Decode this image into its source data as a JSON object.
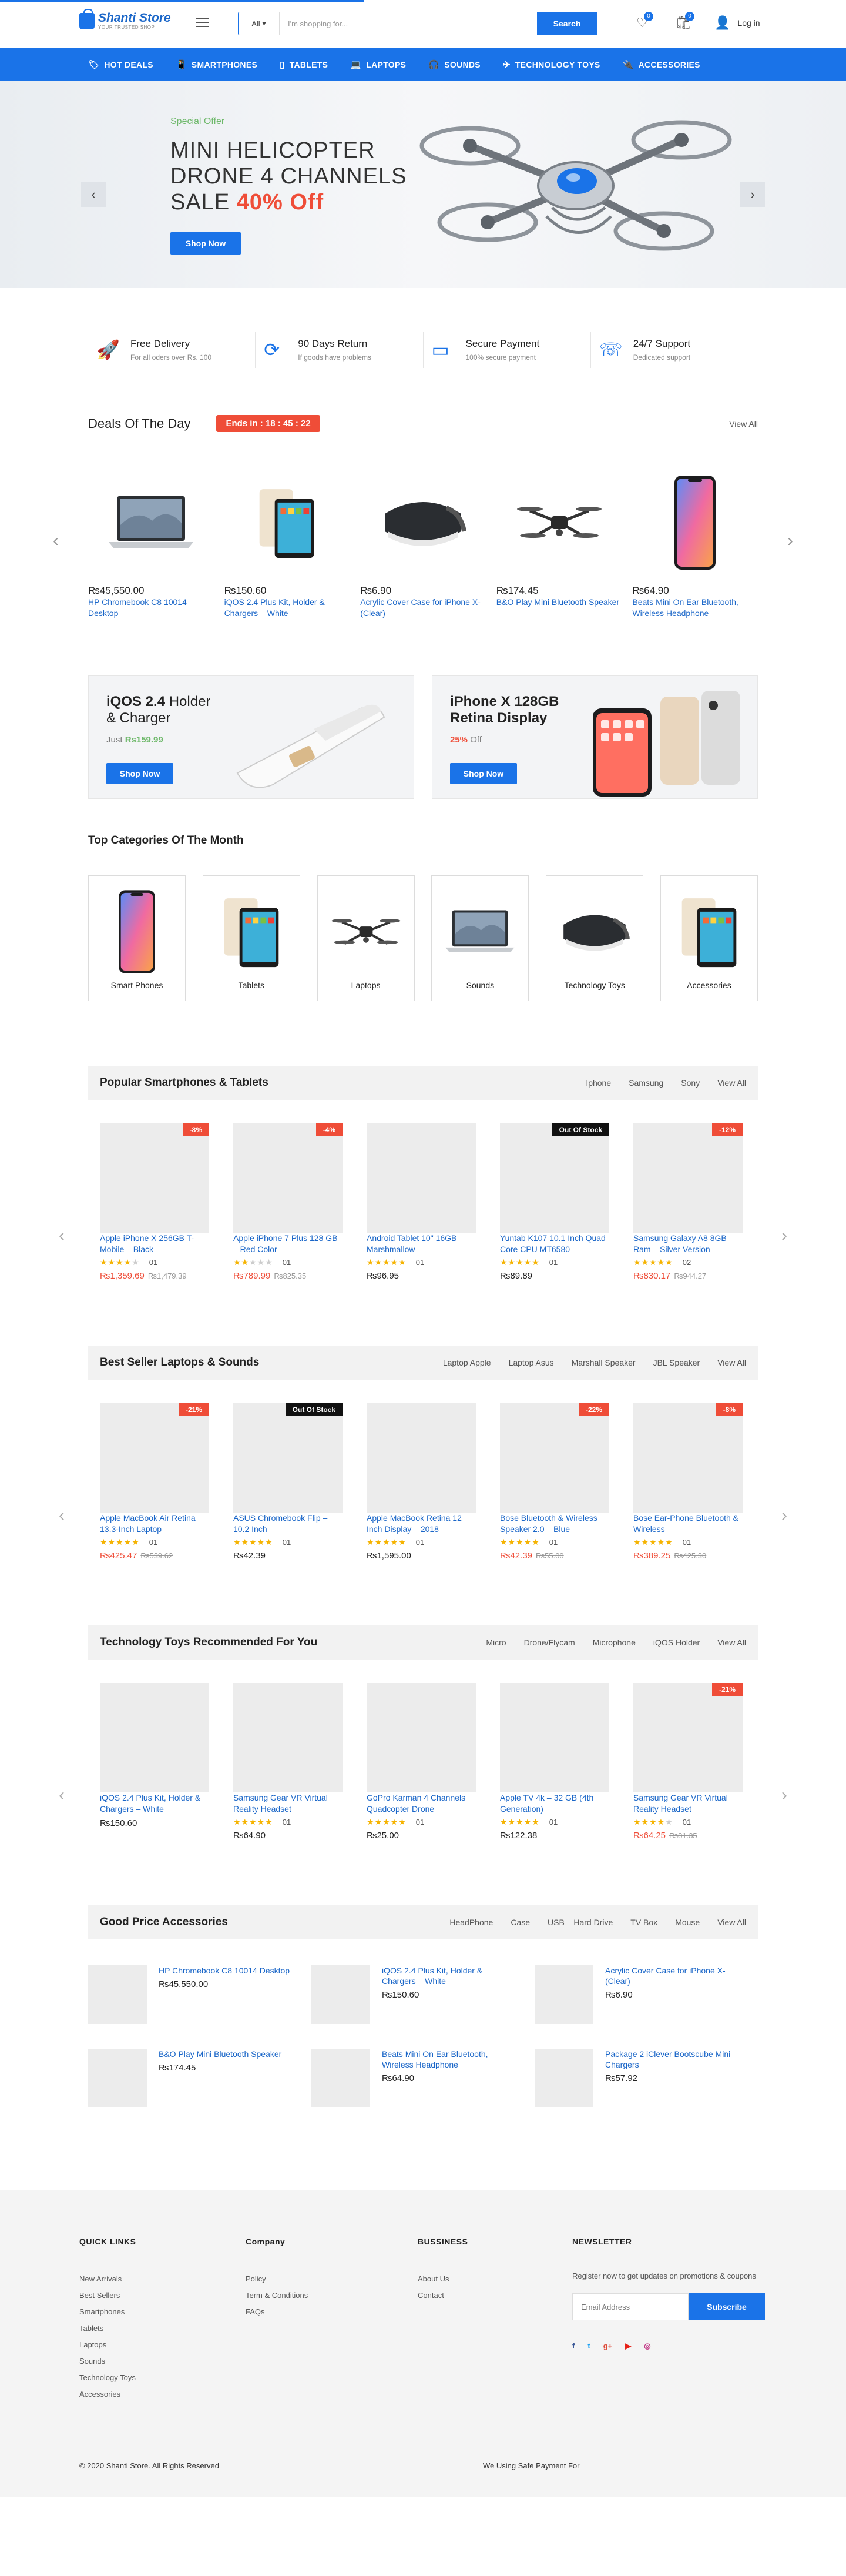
{
  "brand": {
    "name": "Shanti Store",
    "tagline": "YOUR TRUSTED SHOP"
  },
  "header": {
    "search_category": "All",
    "search_placeholder": "I'm shopping for...",
    "search_button": "Search",
    "wishlist_count": "0",
    "cart_count": "0",
    "login_label": "Log in"
  },
  "nav": [
    {
      "label": "HOT DEALS",
      "icon": "tag-icon"
    },
    {
      "label": "SMARTPHONES",
      "icon": "phone-icon"
    },
    {
      "label": "TABLETS",
      "icon": "tablet-icon"
    },
    {
      "label": "LAPTOPS",
      "icon": "laptop-icon"
    },
    {
      "label": "SOUNDS",
      "icon": "headphones-icon"
    },
    {
      "label": "TECHNOLOGY TOYS",
      "icon": "drone-icon"
    },
    {
      "label": "ACCESSORIES",
      "icon": "accessory-icon"
    }
  ],
  "hero": {
    "offer_label": "Special Offer",
    "title_line1": "MINI HELICOPTER",
    "title_line2": "DRONE 4 CHANNELS",
    "title_line3_prefix": "SALE ",
    "title_off": "40% Off",
    "button": "Shop Now"
  },
  "features": [
    {
      "title": "Free Delivery",
      "sub": "For all oders over Rs. 100",
      "icon": "rocket-icon"
    },
    {
      "title": "90 Days Return",
      "sub": "If goods have problems",
      "icon": "refresh-icon"
    },
    {
      "title": "Secure Payment",
      "sub": "100% secure payment",
      "icon": "credit-card-icon"
    },
    {
      "title": "24/7 Support",
      "sub": "Dedicated support",
      "icon": "support-icon"
    }
  ],
  "deals": {
    "title": "Deals Of The Day",
    "countdown": "Ends in : 18 : 45 : 22",
    "view_all": "View All",
    "items": [
      {
        "price": "₨45,550.00",
        "name": "HP Chromebook C8 10014 Desktop",
        "icon": "laptop-image"
      },
      {
        "price": "₨150.60",
        "name": "iQOS 2.4 Plus Kit, Holder & Chargers – White",
        "icon": "tablet-image"
      },
      {
        "price": "₨6.90",
        "name": "Acrylic Cover Case for iPhone X- (Clear)",
        "icon": "vr-headset-image"
      },
      {
        "price": "₨174.45",
        "name": "B&O Play Mini Bluetooth Speaker",
        "icon": "drone-image"
      },
      {
        "price": "₨64.90",
        "name": "Beats Mini On Ear Bluetooth, Wireless Headphone",
        "icon": "phone-image"
      }
    ]
  },
  "banners": [
    {
      "title_bold": "iQOS 2.4",
      "title_rest": " Holder",
      "title_line2": "& Charger",
      "price_prefix": "Just ",
      "price": "Rs159.99",
      "price_suffix": "",
      "button": "Shop Now"
    },
    {
      "title_bold": "iPhone X 128GB",
      "title_rest": "",
      "title_line2": "Retina Display",
      "price_prefix": "",
      "price": "25%",
      "price_suffix": " Off",
      "button": "Shop Now"
    }
  ],
  "categories": {
    "title": "Top Categories Of The Month",
    "items": [
      {
        "name": "Smart Phones",
        "icon": "phone-image"
      },
      {
        "name": "Tablets",
        "icon": "tablet-image"
      },
      {
        "name": "Laptops",
        "icon": "drone-image"
      },
      {
        "name": "Sounds",
        "icon": "laptop-image"
      },
      {
        "name": "Technology Toys",
        "icon": "vr-headset-image"
      },
      {
        "name": "Accessories",
        "icon": "tablet-image"
      }
    ]
  },
  "sections": [
    {
      "title": "Popular Smartphones & Tablets",
      "tabs": [
        "Iphone",
        "Samsung",
        "Sony",
        "View All"
      ],
      "products": [
        {
          "badge": "-8%",
          "badge_type": "sale",
          "name": "Apple iPhone X 256GB T-Mobile – Black",
          "stars": 4,
          "reviews": "01",
          "price": "₨1,359.69",
          "old_price": "₨1,479.39"
        },
        {
          "badge": "-4%",
          "badge_type": "sale",
          "name": "Apple iPhone 7 Plus 128 GB – Red Color",
          "stars": 2,
          "reviews": "01",
          "price": "₨789.99",
          "old_price": "₨825.35"
        },
        {
          "badge": "",
          "badge_type": "",
          "name": "Android Tablet 10\" 16GB Marshmallow",
          "stars": 5,
          "reviews": "01",
          "price": "₨96.95",
          "old_price": ""
        },
        {
          "badge": "Out Of Stock",
          "badge_type": "stock",
          "name": "Yuntab K107 10.1 Inch Quad Core CPU MT6580",
          "stars": 5,
          "reviews": "01",
          "price": "₨89.89",
          "old_price": ""
        },
        {
          "badge": "-12%",
          "badge_type": "sale",
          "name": "Samsung Galaxy A8 8GB Ram – Silver Version",
          "stars": 5,
          "reviews": "02",
          "price": "₨830.17",
          "old_price": "₨944.27"
        }
      ]
    },
    {
      "title": "Best Seller Laptops & Sounds",
      "tabs": [
        "Laptop Apple",
        "Laptop Asus",
        "Marshall Speaker",
        "JBL Speaker",
        "View All"
      ],
      "products": [
        {
          "badge": "-21%",
          "badge_type": "sale",
          "name": "Apple MacBook Air Retina 13.3-Inch Laptop",
          "stars": 5,
          "reviews": "01",
          "price": "₨425.47",
          "old_price": "₨539.62"
        },
        {
          "badge": "Out Of Stock",
          "badge_type": "stock",
          "name": "ASUS Chromebook Flip – 10.2 Inch",
          "stars": 5,
          "reviews": "01",
          "price": "₨42.39",
          "old_price": ""
        },
        {
          "badge": "",
          "badge_type": "",
          "name": "Apple MacBook Retina 12 Inch Display – 2018",
          "stars": 5,
          "reviews": "01",
          "price": "₨1,595.00",
          "old_price": ""
        },
        {
          "badge": "-22%",
          "badge_type": "sale",
          "name": "Bose Bluetooth & Wireless Speaker 2.0 – Blue",
          "stars": 5,
          "reviews": "01",
          "price": "₨42.39",
          "old_price": "₨55.00"
        },
        {
          "badge": "-8%",
          "badge_type": "sale",
          "name": "Bose Ear-Phone Bluetooth & Wireless",
          "stars": 5,
          "reviews": "01",
          "price": "₨389.25",
          "old_price": "₨425.30"
        }
      ]
    },
    {
      "title": "Technology Toys Recommended For You",
      "tabs": [
        "Micro",
        "Drone/Flycam",
        "Microphone",
        "iQOS Holder",
        "View All"
      ],
      "products": [
        {
          "badge": "",
          "badge_type": "",
          "name": "iQOS 2.4 Plus Kit, Holder & Chargers – White",
          "stars": 0,
          "reviews": "",
          "price": "₨150.60",
          "old_price": ""
        },
        {
          "badge": "",
          "badge_type": "",
          "name": "Samsung Gear VR Virtual Reality Headset",
          "stars": 5,
          "reviews": "01",
          "price": "₨64.90",
          "old_price": ""
        },
        {
          "badge": "",
          "badge_type": "",
          "name": "GoPro Karman 4 Channels Quadcopter Drone",
          "stars": 5,
          "reviews": "01",
          "price": "₨25.00",
          "old_price": ""
        },
        {
          "badge": "",
          "badge_type": "",
          "name": "Apple TV 4k – 32 GB (4th Generation)",
          "stars": 5,
          "reviews": "01",
          "price": "₨122.38",
          "old_price": ""
        },
        {
          "badge": "-21%",
          "badge_type": "sale",
          "name": "Samsung Gear VR Virtual Reality Headset",
          "stars": 4,
          "reviews": "01",
          "price": "₨64.25",
          "old_price": "₨81.35"
        }
      ]
    }
  ],
  "accessories": {
    "title": "Good Price Accessories",
    "tabs": [
      "HeadPhone",
      "Case",
      "USB – Hard Drive",
      "TV Box",
      "Mouse",
      "View All"
    ],
    "items": [
      {
        "name": "HP Chromebook C8 10014 Desktop",
        "price": "₨45,550.00"
      },
      {
        "name": "iQOS 2.4 Plus Kit, Holder & Chargers – White",
        "price": "₨150.60"
      },
      {
        "name": "Acrylic Cover Case for iPhone X- (Clear)",
        "price": "₨6.90"
      },
      {
        "name": "B&O Play Mini Bluetooth Speaker",
        "price": "₨174.45"
      },
      {
        "name": "Beats Mini On Ear Bluetooth, Wireless Headphone",
        "price": "₨64.90"
      },
      {
        "name": "Package 2 iClever Bootscube Mini Chargers",
        "price": "₨57.92"
      }
    ]
  },
  "footer": {
    "quick_links_title": "QUICK LINKS",
    "quick_links": [
      "New Arrivals",
      "Best Sellers",
      "Smartphones",
      "Tablets",
      "Laptops",
      "Sounds",
      "Technology Toys",
      "Accessories"
    ],
    "company_title": "Company",
    "company_links": [
      "Policy",
      "Term & Conditions",
      "FAQs"
    ],
    "business_title": "BUSSINESS",
    "business_links": [
      "About Us",
      "Contact"
    ],
    "newsletter_title": "NEWSLETTER",
    "newsletter_text": "Register now to get updates on promotions & coupons",
    "email_placeholder": "Email Address",
    "subscribe": "Subscribe",
    "social": [
      "f",
      "t",
      "g+",
      "▶",
      "◎"
    ],
    "copyright": "© 2020 Shanti Store. All Rights Reserved",
    "payment": "We Using Safe Payment For"
  },
  "colors": {
    "primary": "#1a73e8",
    "sale": "#ef4d38",
    "accent_green": "#6fb96b"
  }
}
